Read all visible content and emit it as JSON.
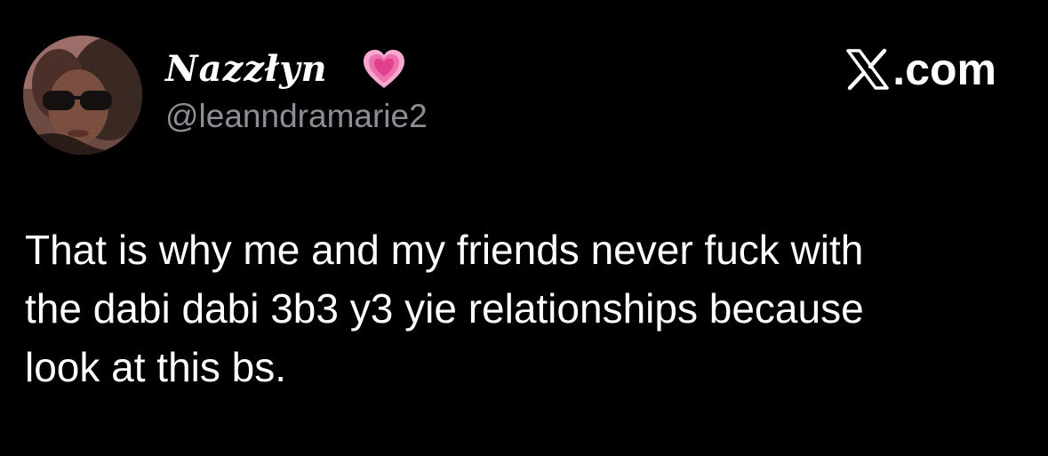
{
  "author": {
    "display_name": "Nazzłyn",
    "handle": "@leanndramarie2",
    "name_emoji_icon": "growing-heart-icon"
  },
  "brand": {
    "icon": "x-logo-icon",
    "text": ".com"
  },
  "tweet": {
    "lines": [
      "That is why me and my friends never fuck with",
      "the dabi dabi 3b3 y3 yie relationships because",
      "look at this bs."
    ]
  },
  "colors": {
    "background": "#000000",
    "text": "#ffffff",
    "handle": "#8b8f95",
    "heart": "#f06aa8"
  }
}
